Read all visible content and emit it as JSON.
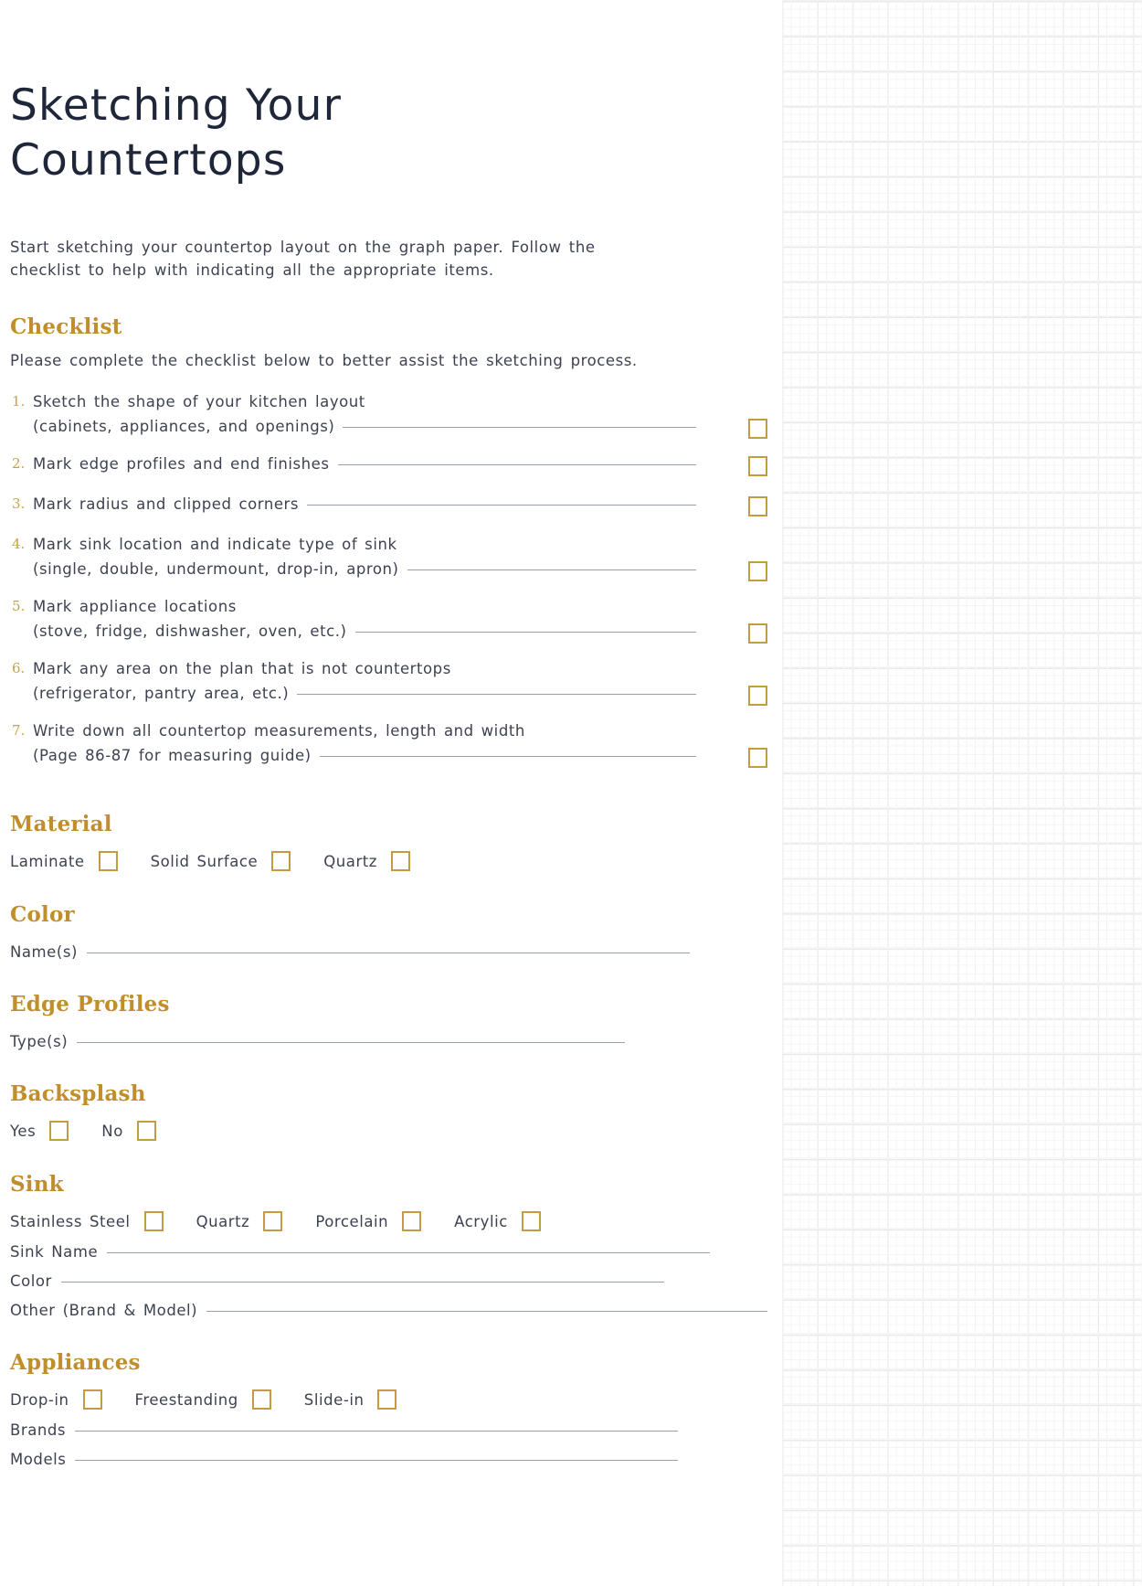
{
  "page": {
    "title": "Sketching Your Countertops",
    "intro": "Start sketching your countertop layout on the graph paper. Follow the checklist to help with indicating all the appropriate items.",
    "accent_color": "#c08e2b",
    "checkbox_color": "#c49a43",
    "text_color": "#3d4250",
    "title_color": "#1f2639",
    "rule_color": "#9aa0aa"
  },
  "checklist": {
    "heading": "Checklist",
    "note": "Please complete the checklist below to better assist the sketching process.",
    "items": [
      {
        "num": "1.",
        "line1": "Sketch the shape of your kitchen layout",
        "line2": "(cabinets, appliances, and openings)"
      },
      {
        "num": "2.",
        "line1": "Mark edge profiles and end finishes",
        "line2": ""
      },
      {
        "num": "3.",
        "line1": "Mark radius and clipped corners",
        "line2": ""
      },
      {
        "num": "4.",
        "line1": "Mark sink location and indicate type of sink",
        "line2": "(single, double, undermount, drop-in, apron)"
      },
      {
        "num": "5.",
        "line1": "Mark appliance locations",
        "line2": "(stove, fridge, dishwasher, oven, etc.)"
      },
      {
        "num": "6.",
        "line1": "Mark any area on the plan that is not countertops",
        "line2": "(refrigerator, pantry area, etc.)"
      },
      {
        "num": "7.",
        "line1": "Write down all countertop measurements, length and width",
        "line2": "(Page 86-87 for measuring guide)"
      }
    ]
  },
  "material": {
    "heading": "Material",
    "options": [
      "Laminate",
      "Solid Surface",
      "Quartz"
    ]
  },
  "color": {
    "heading": "Color",
    "field_label": "Name(s)"
  },
  "edge_profiles": {
    "heading": "Edge Profiles",
    "field_label": "Type(s)"
  },
  "backsplash": {
    "heading": "Backsplash",
    "options": [
      "Yes",
      "No"
    ]
  },
  "sink": {
    "heading": "Sink",
    "options": [
      "Stainless Steel",
      "Quartz",
      "Porcelain",
      "Acrylic"
    ],
    "fields": [
      "Sink Name",
      "Color",
      "Other (Brand & Model)"
    ]
  },
  "appliances": {
    "heading": "Appliances",
    "options": [
      "Drop-in",
      "Freestanding",
      "Slide-in"
    ],
    "fields": [
      "Brands",
      "Models"
    ]
  }
}
